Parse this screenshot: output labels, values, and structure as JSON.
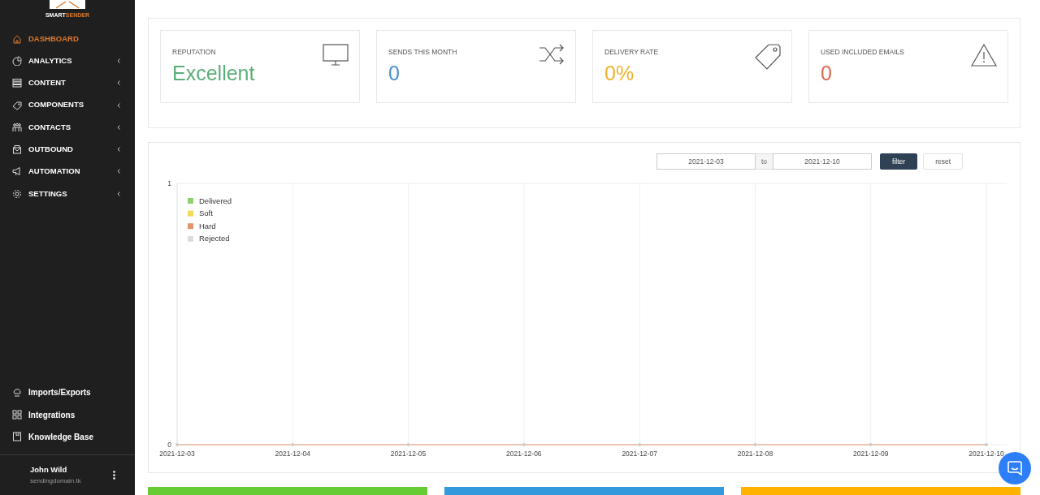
{
  "sidebar": {
    "logo": [
      "SMART",
      "SENDER"
    ],
    "items": [
      {
        "label": "DASHBOARD",
        "selected": true,
        "expandable": false
      },
      {
        "label": "ANALYTICS",
        "selected": false,
        "expandable": true
      },
      {
        "label": "CONTENT",
        "selected": false,
        "expandable": true
      },
      {
        "label": "COMPONENTS",
        "selected": false,
        "expandable": true
      },
      {
        "label": "CONTACTS",
        "selected": false,
        "expandable": true
      },
      {
        "label": "OUTBOUND",
        "selected": false,
        "expandable": true
      },
      {
        "label": "AUTOMATION",
        "selected": false,
        "expandable": true
      },
      {
        "label": "SETTINGS",
        "selected": false,
        "expandable": true
      }
    ],
    "bottom_items": [
      {
        "label": "Imports/Exports"
      },
      {
        "label": "Integrations"
      },
      {
        "label": "Knowledge Base"
      }
    ],
    "user": {
      "name": "John Wild",
      "domain": "sendingdomain.tk"
    }
  },
  "stats": [
    {
      "label": "REPUTATION",
      "value": "Excellent",
      "color": "#5cae78"
    },
    {
      "label": "SENDS THIS MONTH",
      "value": "0",
      "color": "#4a90d2"
    },
    {
      "label": "DELIVERY RATE",
      "value": "0%",
      "color": "#f2b12c"
    },
    {
      "label": "USED INCLUDED EMAILS",
      "value": "0",
      "color": "#e0674c"
    }
  ],
  "date_filter": {
    "from": "2021-12-03",
    "separator": "to",
    "to": "2021-12-10",
    "filter_button": "filter",
    "reset_button": "reset"
  },
  "chart_data": {
    "type": "line",
    "categories": [
      "2021-12-03",
      "2021-12-04",
      "2021-12-05",
      "2021-12-06",
      "2021-12-07",
      "2021-12-08",
      "2021-12-09",
      "2021-12-10"
    ],
    "series": [
      {
        "name": "Delivered",
        "color": "#8fd16f",
        "values": [
          null,
          null,
          null,
          null,
          null,
          null,
          null,
          null
        ]
      },
      {
        "name": "Soft",
        "color": "#f0d858",
        "values": [
          null,
          null,
          null,
          null,
          null,
          null,
          null,
          null
        ]
      },
      {
        "name": "Hard",
        "color": "#e8916d",
        "values": [
          0,
          0,
          0,
          0,
          0,
          0,
          0,
          0
        ]
      },
      {
        "name": "Rejected",
        "color": "#dddddd",
        "values": [
          null,
          null,
          null,
          null,
          null,
          null,
          null,
          null
        ]
      }
    ],
    "ylim": [
      0,
      1
    ],
    "yticks": [
      {
        "value": 0,
        "label": "0"
      },
      {
        "value": 1,
        "label": "1"
      }
    ],
    "grid": {
      "x": true,
      "y": true
    },
    "legend": true
  },
  "bottom_panels": [
    {
      "color": "#66cc33"
    },
    {
      "color": "#3399dd"
    },
    {
      "color": "#ffb300"
    }
  ]
}
